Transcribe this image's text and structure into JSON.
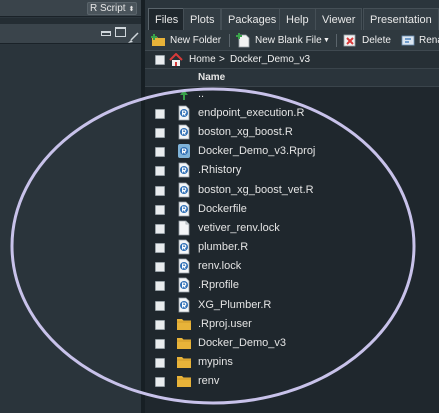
{
  "left_pane": {
    "script_type": "R Script"
  },
  "tabs": [
    {
      "label": "Files",
      "active": true
    },
    {
      "label": "Plots",
      "active": false
    },
    {
      "label": "Packages",
      "active": false
    },
    {
      "label": "Help",
      "active": false
    },
    {
      "label": "Viewer",
      "active": false
    },
    {
      "label": "Presentation",
      "active": false
    }
  ],
  "toolbar": {
    "new_folder": "New Folder",
    "new_blank_file": "New Blank File",
    "delete": "Delete",
    "rename": "Rena"
  },
  "breadcrumb": {
    "home": "Home",
    "separator": ">",
    "folder": "Docker_Demo_v3"
  },
  "list": {
    "column_header": "Name",
    "parent": "..",
    "files": [
      {
        "name": "endpoint_execution.R",
        "icon": "r-file-icon"
      },
      {
        "name": "boston_xg_boost.R",
        "icon": "r-file-icon"
      },
      {
        "name": "Docker_Demo_v3.Rproj",
        "icon": "rproj-icon"
      },
      {
        "name": ".Rhistory",
        "icon": "r-file-icon"
      },
      {
        "name": "boston_xg_boost_vet.R",
        "icon": "r-file-icon"
      },
      {
        "name": "Dockerfile",
        "icon": "r-file-icon"
      },
      {
        "name": "vetiver_renv.lock",
        "icon": "text-file-icon"
      },
      {
        "name": "plumber.R",
        "icon": "r-file-icon"
      },
      {
        "name": "renv.lock",
        "icon": "r-file-icon"
      },
      {
        "name": ".Rprofile",
        "icon": "r-file-icon"
      },
      {
        "name": "XG_Plumber.R",
        "icon": "r-file-icon"
      },
      {
        "name": ".Rproj.user",
        "icon": "folder-icon"
      },
      {
        "name": "Docker_Demo_v3",
        "icon": "folder-icon"
      },
      {
        "name": "mypins",
        "icon": "folder-icon"
      },
      {
        "name": "renv",
        "icon": "folder-icon"
      }
    ]
  },
  "colors": {
    "annotation_ellipse": "#c8c2ea",
    "folder": "#e8b339",
    "r_blue": "#2f6fb5",
    "delete_red": "#d83a3a",
    "new_green": "#3aa24a"
  }
}
